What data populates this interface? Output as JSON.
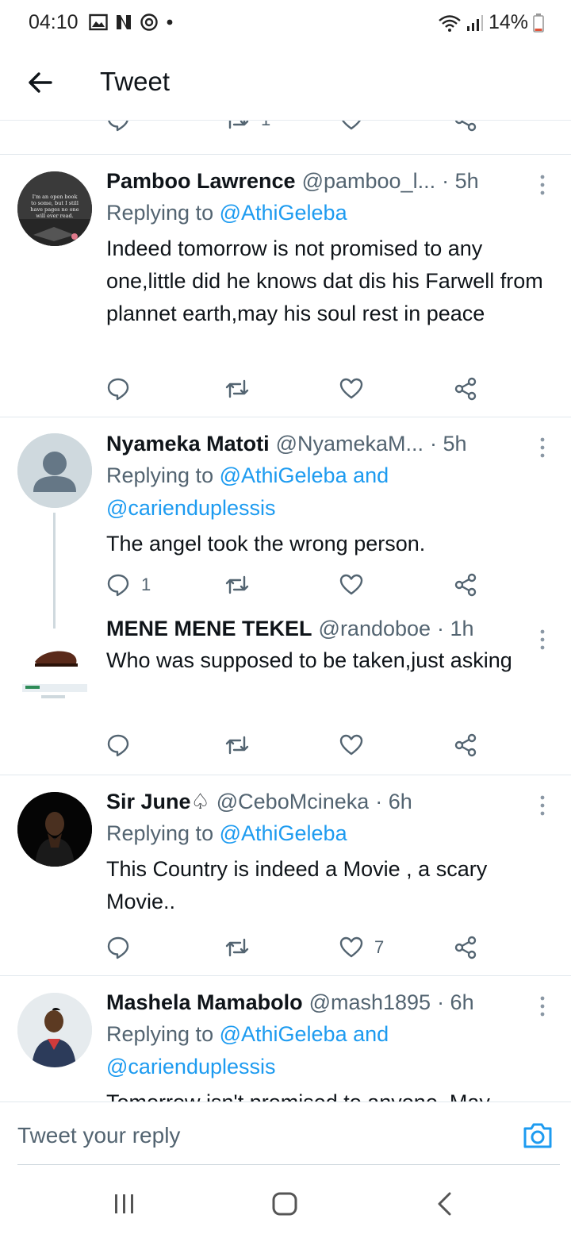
{
  "status_bar": {
    "time": "04:10",
    "battery": "14%"
  },
  "header": {
    "title": "Tweet"
  },
  "top_partial_actions": {
    "retweet_count": "1"
  },
  "tweets": [
    {
      "name": "Pamboo Lawrence",
      "handle": "@pamboo_l...",
      "time": "· 5h",
      "replying_prefix": "Replying to ",
      "replying_to": "@AthiGeleba",
      "replying_to_2": "",
      "text": "Indeed tomorrow is not promised to any one,little did he knows dat dis his Farwell from plannet earth,may his soul rest in peace",
      "avatar_text": "I'm an open book to some, but I still have pages no one will ever read.",
      "reply_count": "",
      "like_count": ""
    },
    {
      "name": "Nyameka Matoti",
      "handle": "@NyamekaM...",
      "time": "· 5h",
      "replying_prefix": "Replying to ",
      "replying_to": "@AthiGeleba and",
      "replying_to_2": "@carienduplessis",
      "text": "The angel took the wrong person.",
      "reply_count": "1",
      "like_count": ""
    },
    {
      "name": "MENE MENE TEKEL",
      "handle": "@randoboe",
      "time": "· 1h",
      "text": "Who was supposed to be taken,just asking",
      "reply_count": "",
      "like_count": ""
    },
    {
      "name": "Sir June♤",
      "handle": "@CeboMcineka",
      "time": "· 6h",
      "replying_prefix": "Replying to ",
      "replying_to": "@AthiGeleba",
      "text": "This Country is indeed a Movie , a scary Movie..",
      "reply_count": "",
      "like_count": "7"
    },
    {
      "name": "Mashela Mamabolo",
      "handle": "@mash1895",
      "time": "· 6h",
      "replying_prefix": "Replying to ",
      "replying_to": "@AthiGeleba and",
      "replying_to_2": "@carienduplessis",
      "text": "Tomorrow isn't promised to anyone. May"
    }
  ],
  "reply_bar": {
    "placeholder": "Tweet your reply"
  },
  "colors": {
    "accent": "#1d9bf0",
    "muted": "#536471",
    "text": "#0f1419"
  }
}
